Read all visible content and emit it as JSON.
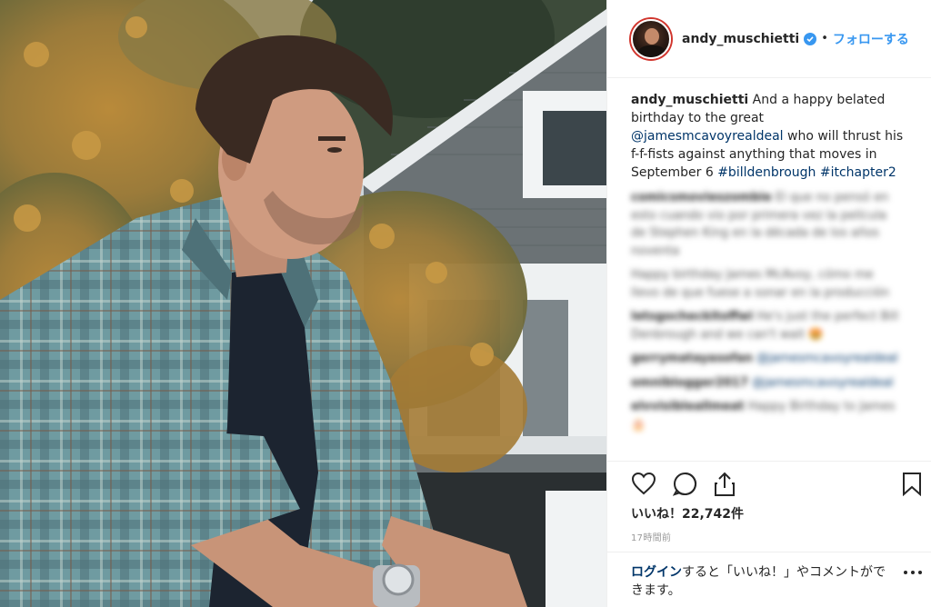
{
  "post": {
    "username": "andy_muschietti",
    "separator": "•",
    "follow_label": "フォローする",
    "caption_text_1": "And a happy belated birthday to the great",
    "caption_mention": "@jamesmcavoyrealdeal",
    "caption_text_2": "who will thrust his f-f-fists against anything that moves in September 6",
    "caption_tag_1": "#billdenbrough",
    "caption_tag_2": "#itchapter2"
  },
  "comments": [
    {
      "user": "comicsmovieszombie",
      "text": "El que no pensó en esto cuando vio por primera vez la película de Stephen King en la década de los años noventa"
    },
    {
      "user": "",
      "text": "Happy birthday James McAvoy, cómo me llevo de que fuese a sonar en la producción"
    },
    {
      "user": "letsgocheckitoffwi",
      "text": "He's just the perfect Bill Denbrough and we can't wait 🤩"
    },
    {
      "user": "gerrymatayasofan",
      "text": "@jamesmcavoyrealdeal"
    },
    {
      "user": "omniblogger2017",
      "text": "@jamesmcavoyrealdeal"
    },
    {
      "user": "elvvisibleallmeat",
      "text": "Happy Birthday to James 🎂"
    }
  ],
  "stats": {
    "likes": "いいね！22,742件",
    "timestamp": "17時間前"
  },
  "login": {
    "link": "ログイン",
    "text": "すると「いいね！」やコメントができます。"
  },
  "icons": {
    "verified": "verified-badge-icon",
    "like": "heart-icon",
    "comment": "comment-bubble-icon",
    "share": "share-icon",
    "save": "bookmark-icon",
    "more": "more-dots-icon"
  },
  "colors": {
    "accent": "#3897f0",
    "link": "#003569",
    "text": "#262626",
    "muted": "#999999"
  }
}
